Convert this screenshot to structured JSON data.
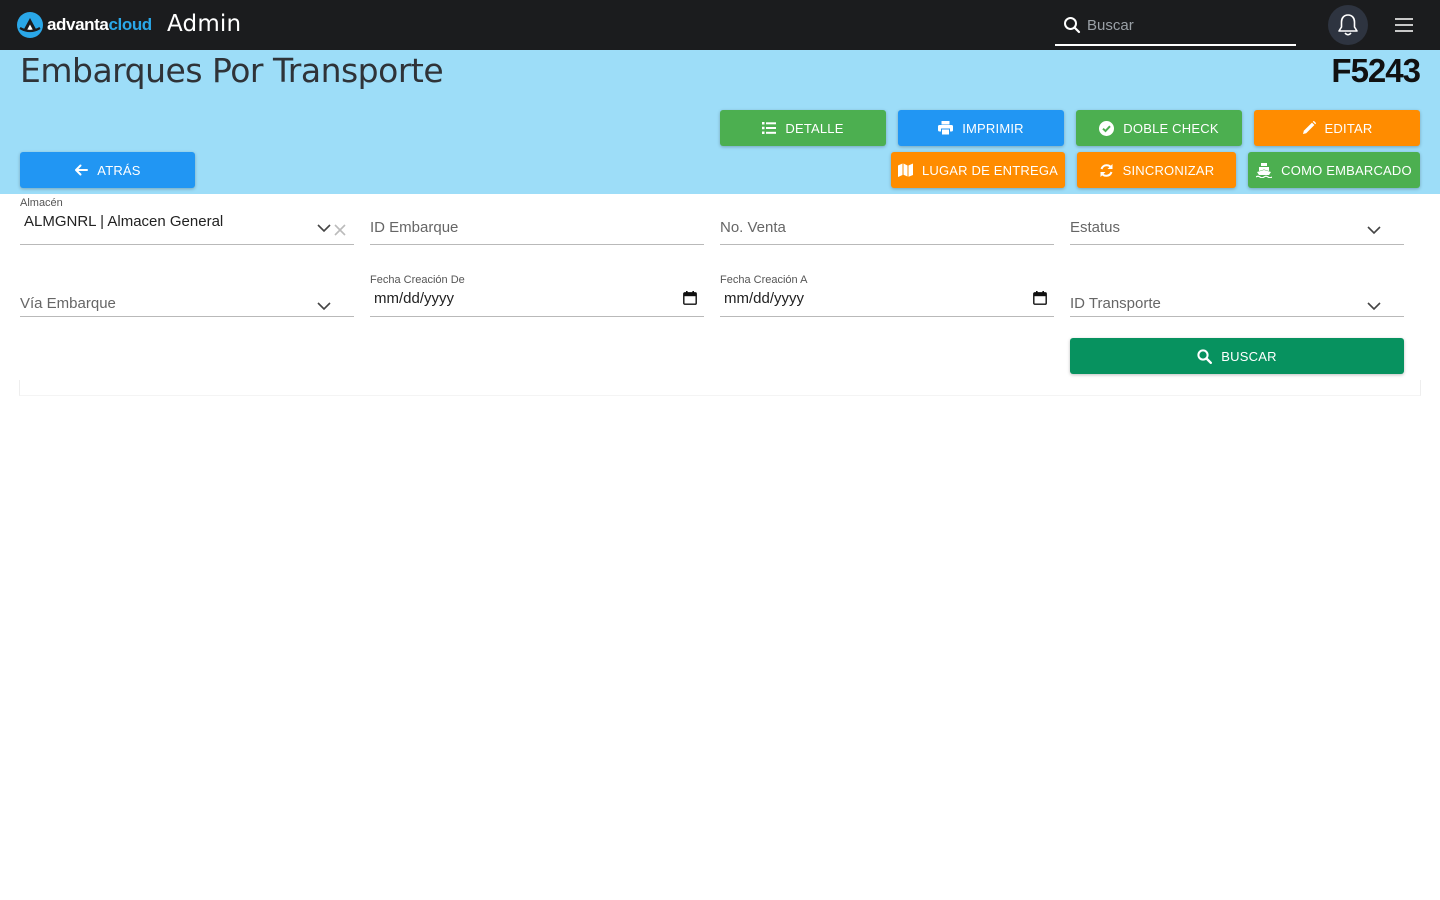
{
  "navbar": {
    "logo_word_1": "advanta",
    "logo_word_2": "cloud",
    "app_title": "Admin",
    "search_placeholder": "Buscar"
  },
  "header": {
    "title": "Embarques Por Transporte",
    "code": "F5243"
  },
  "buttons": {
    "detalle": "DETALLE",
    "imprimir": "IMPRIMIR",
    "doble_check": "DOBLE CHECK",
    "editar": "EDITAR",
    "atras": "ATRÁS",
    "lugar_entrega": "LUGAR DE ENTREGA",
    "sincronizar": "SINCRONIZAR",
    "como_embarcado": "COMO EMBARCADO",
    "buscar": "BUSCAR"
  },
  "form": {
    "almacen": {
      "label": "Almacén",
      "value": "ALMGNRL | Almacen General"
    },
    "id_embarque": {
      "placeholder": "ID Embarque"
    },
    "no_venta": {
      "placeholder": "No. Venta"
    },
    "estatus": {
      "placeholder": "Estatus"
    },
    "via_embarque": {
      "placeholder": "Vía Embarque"
    },
    "fecha_de": {
      "label": "Fecha Creación De",
      "value": "mm/dd/yyyy"
    },
    "fecha_a": {
      "label": "Fecha Creación A",
      "value": "mm/dd/yyyy"
    },
    "id_transporte": {
      "placeholder": "ID Transporte"
    }
  },
  "colors": {
    "navbar": "#1b1c1e",
    "header_band": "#9dddf8",
    "green": "#4caf50",
    "blue": "#2196f3",
    "orange": "#ff8c00",
    "search_button": "#07925f",
    "brand_blue": "#2aa7e8"
  }
}
